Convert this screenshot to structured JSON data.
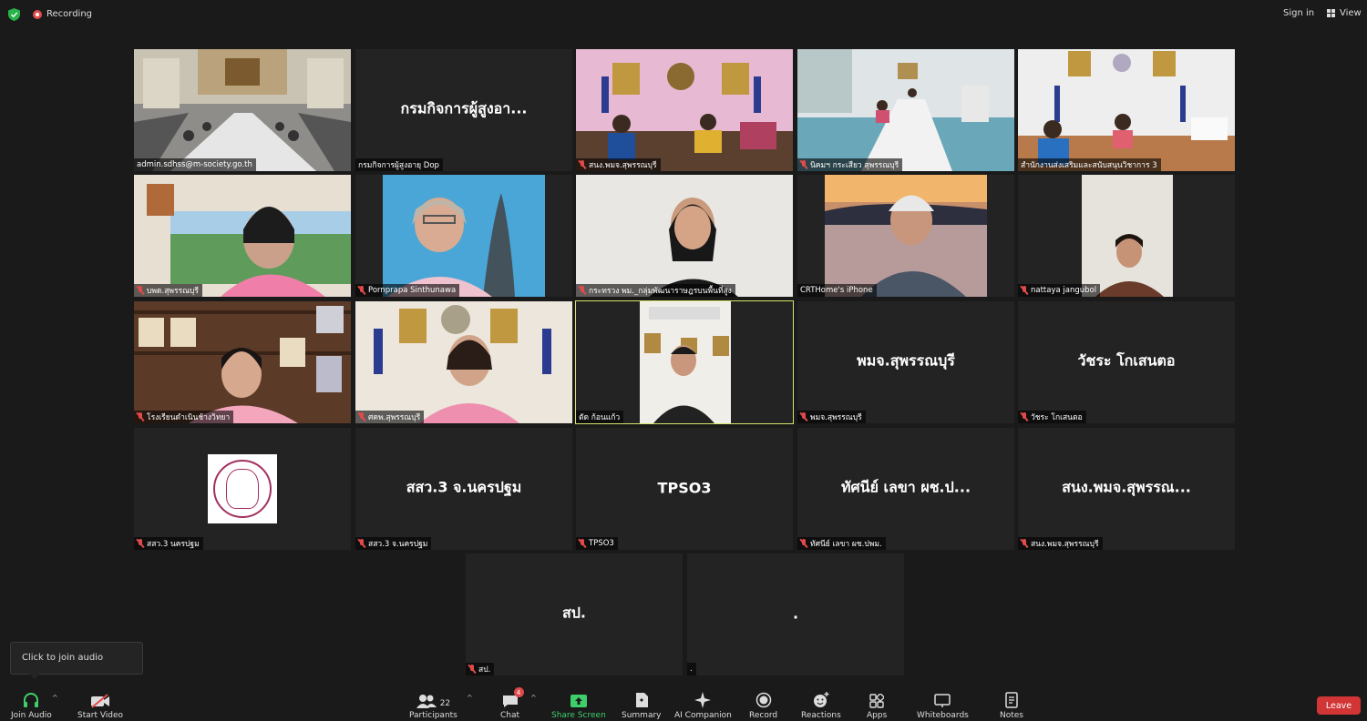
{
  "topbar": {
    "recording_label": "Recording",
    "signin_label": "Sign in",
    "view_label": "View"
  },
  "tiles": [
    {
      "name": "admin.sdhss@m-society.go.th",
      "muted": false,
      "big": ""
    },
    {
      "name": "กรมกิจการผู้สูงอายุ Dop",
      "muted": false,
      "big": "กรมกิจการผู้สูงอา..."
    },
    {
      "name": "สนง.พมจ.สุพรรณบุรี",
      "muted": true,
      "big": ""
    },
    {
      "name": "นิคมฯ กระเสียว สุพรรณบุรี",
      "muted": true,
      "big": ""
    },
    {
      "name": "สำนักงานส่งเสริมและสนับสนุนวิชาการ 3",
      "muted": false,
      "big": ""
    },
    {
      "name": "บพด.สุพรรณบุรี",
      "muted": true,
      "big": ""
    },
    {
      "name": "Pornprapa Sinthunawa",
      "muted": true,
      "big": ""
    },
    {
      "name": "กระทรวง พม._กลุ่มพัฒนาราษฎรบนพื้นที่สูง",
      "muted": true,
      "big": ""
    },
    {
      "name": "CRTHome's iPhone",
      "muted": false,
      "big": ""
    },
    {
      "name": "nattaya jangubol",
      "muted": true,
      "big": ""
    },
    {
      "name": "โรงเรียนดำเนินช้างวิทยา",
      "muted": true,
      "big": ""
    },
    {
      "name": "ศคพ.สุพรรณบุรี",
      "muted": true,
      "big": ""
    },
    {
      "name": "ตัด ก้อนแก้ว",
      "muted": false,
      "big": ""
    },
    {
      "name": "พมจ.สุพรรณบุรี",
      "muted": true,
      "big": "พมจ.สุพรรณบุรี"
    },
    {
      "name": "วัชระ โกเสนตอ",
      "muted": true,
      "big": "วัชระ โกเสนตอ"
    },
    {
      "name": "สสว.3 นครปฐม",
      "muted": true,
      "big": ""
    },
    {
      "name": "สสว.3 จ.นครปฐม",
      "muted": true,
      "big": "สสว.3 จ.นครปฐม"
    },
    {
      "name": "TPSO3",
      "muted": true,
      "big": "TPSO3"
    },
    {
      "name": "ทัศนีย์ เลขา ผช.ปพม.",
      "muted": true,
      "big": "ทัศนีย์ เลขา ผช.ป..."
    },
    {
      "name": "สนง.พมจ.สุพรรณบุรี",
      "muted": true,
      "big": "สนง.พมจ.สุพรรณ..."
    },
    {
      "name": "สป.",
      "muted": true,
      "big": "สป."
    },
    {
      "name": ".",
      "muted": false,
      "big": "."
    }
  ],
  "tooltip": {
    "text": "Click to join audio"
  },
  "toolbar": {
    "join_audio": "Join Audio",
    "start_video": "Start Video",
    "participants": "Participants",
    "participants_count": "22",
    "chat": "Chat",
    "chat_badge": "4",
    "share_screen": "Share Screen",
    "summary": "Summary",
    "ai_companion": "AI Companion",
    "record": "Record",
    "reactions": "Reactions",
    "apps": "Apps",
    "whiteboards": "Whiteboards",
    "notes": "Notes",
    "leave": "Leave"
  },
  "colors": {
    "active_speaker_border": "#d8e36b",
    "leave_button": "#d13535",
    "share_green": "#3ecf6a",
    "muted_red": "#e04a4a"
  }
}
